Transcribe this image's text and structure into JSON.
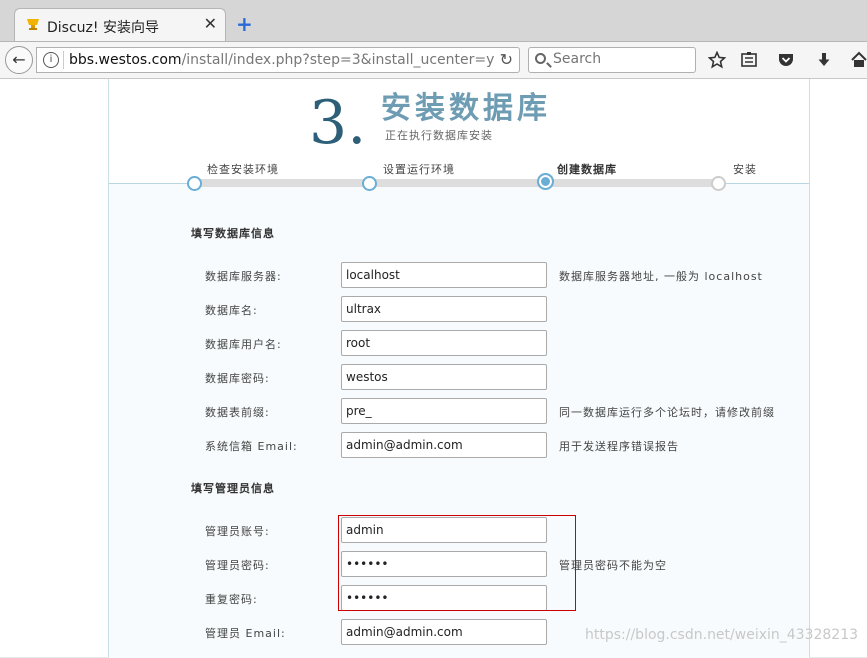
{
  "browser": {
    "tab_title": "Discuz! 安装向导",
    "close_glyph": "✕",
    "new_tab_glyph": "+",
    "back_glyph": "←",
    "info_glyph": "i",
    "url_host": "bbs.westos.com",
    "url_path": "/install/index.php?step=3&install_ucenter=y",
    "reload_glyph": "↻",
    "search_placeholder": "Search",
    "icons": [
      "bookmark-star-icon",
      "reading-list-icon",
      "pocket-icon",
      "download-icon",
      "home-icon"
    ]
  },
  "header": {
    "step_number": "3",
    "step_dot": ".",
    "title": "安装数据库",
    "subtitle": "正在执行数据库安装"
  },
  "steps": [
    {
      "label": "检查安装环境",
      "state": "done"
    },
    {
      "label": "设置运行环境",
      "state": "done"
    },
    {
      "label": "创建数据库",
      "state": "current"
    },
    {
      "label": "安装",
      "state": "todo"
    }
  ],
  "db_section": {
    "title": "填写数据库信息",
    "fields": [
      {
        "label": "数据库服务器:",
        "value": "localhost",
        "hint": "数据库服务器地址, 一般为 localhost"
      },
      {
        "label": "数据库名:",
        "value": "ultrax",
        "hint": ""
      },
      {
        "label": "数据库用户名:",
        "value": "root",
        "hint": ""
      },
      {
        "label": "数据库密码:",
        "value": "westos",
        "hint": ""
      },
      {
        "label": "数据表前缀:",
        "value": "pre_",
        "hint": "同一数据库运行多个论坛时，请修改前缀"
      },
      {
        "label": "系统信箱 Email:",
        "value": "admin@admin.com",
        "hint": "用于发送程序错误报告"
      }
    ]
  },
  "admin_section": {
    "title": "填写管理员信息",
    "fields": [
      {
        "label": "管理员账号:",
        "value": "admin",
        "hint": ""
      },
      {
        "label": "管理员密码:",
        "value": "••••••",
        "hint": "管理员密码不能为空"
      },
      {
        "label": "重复密码:",
        "value": "••••••",
        "hint": ""
      },
      {
        "label": "管理员 Email:",
        "value": "admin@admin.com",
        "hint": ""
      }
    ]
  },
  "watermark": "https://blog.csdn.net/weixin_43328213",
  "colors": {
    "accent": "#6aaed6",
    "title": "#6e9cb3",
    "highlight_box": "#cc0000"
  }
}
